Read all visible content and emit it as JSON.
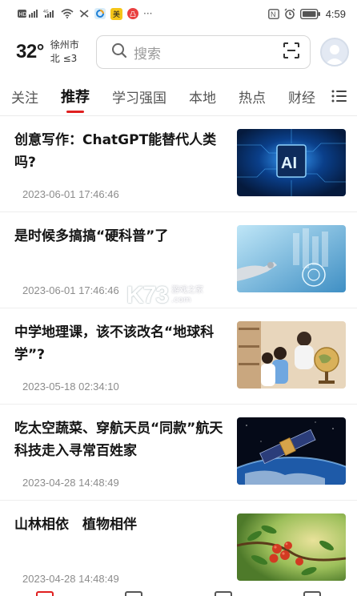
{
  "status_bar": {
    "time": "4:59",
    "left_icons": [
      "hd-signal-icon",
      "4g-signal-icon",
      "wifi-icon",
      "vibrate-icon",
      "app-notification-icon",
      "meituan-icon",
      "weibo-icon",
      "more-dots-icon"
    ],
    "right_icons": [
      "nfc-icon",
      "alarm-icon",
      "battery-icon"
    ],
    "meituan_label": "美",
    "more_label": "···"
  },
  "weather": {
    "temperature": "32°",
    "city": "徐州市",
    "wind": "北 ≤3"
  },
  "search": {
    "placeholder": "搜索"
  },
  "tabs": [
    {
      "label": "关注"
    },
    {
      "label": "推荐"
    },
    {
      "label": "学习强国"
    },
    {
      "label": "本地"
    },
    {
      "label": "热点"
    },
    {
      "label": "财经"
    }
  ],
  "active_tab": "推荐",
  "news": [
    {
      "title": "创意写作：ChatGPT能替代人类吗?",
      "time": "2023-06-01 17:46:46",
      "thumb": "ai-chip-image"
    },
    {
      "title": "是时候多搞搞“硬科普”了",
      "time": "2023-06-01 17:46:46",
      "thumb": "robot-hand-image"
    },
    {
      "title": "中学地理课，该不该改名“地球科学”?",
      "time": "2023-05-18 02:34:10",
      "thumb": "globe-classroom-image"
    },
    {
      "title": "吃太空蔬菜、穿航天员“同款”航天科技走入寻常百姓家",
      "time": "2023-04-28 14:48:49",
      "thumb": "satellite-earth-image"
    },
    {
      "title": "山林相依　植物相伴",
      "time": "2023-04-28 14:48:49",
      "thumb": "red-berries-image"
    }
  ],
  "watermark": {
    "logo": "K73",
    "text_line1": "游戏之家",
    "text_line2": ".com"
  },
  "colors": {
    "accent": "#e02020",
    "text_primary": "#151515",
    "text_secondary": "#8c8c8c"
  }
}
